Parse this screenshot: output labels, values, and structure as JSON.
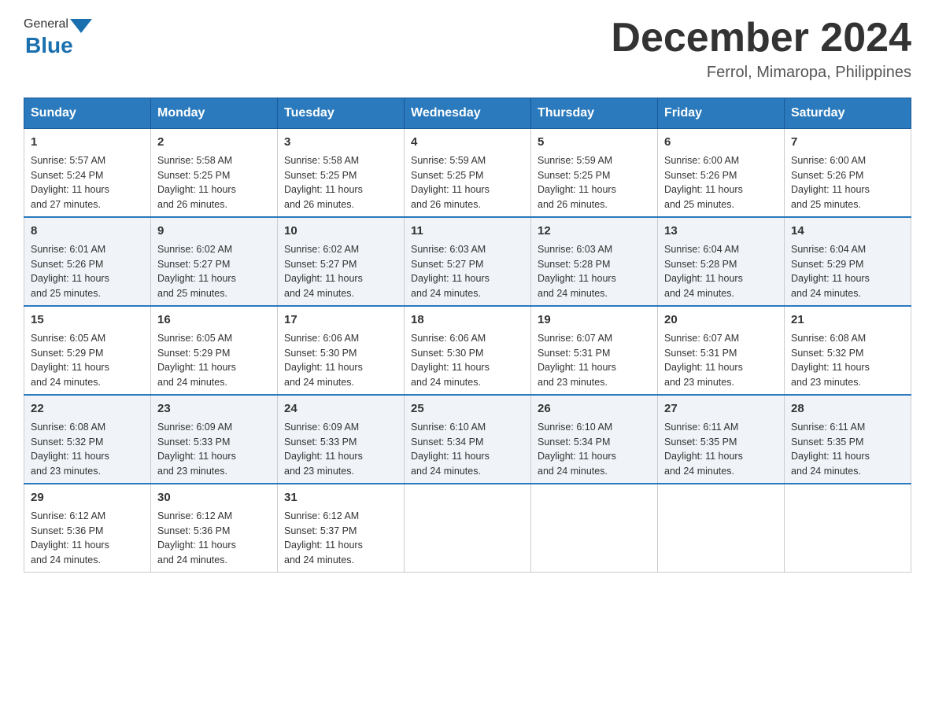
{
  "header": {
    "title": "December 2024",
    "location": "Ferrol, Mimaropa, Philippines",
    "logo_general": "General",
    "logo_blue": "Blue"
  },
  "days_of_week": [
    "Sunday",
    "Monday",
    "Tuesday",
    "Wednesday",
    "Thursday",
    "Friday",
    "Saturday"
  ],
  "weeks": [
    [
      {
        "day": "1",
        "sunrise": "5:57 AM",
        "sunset": "5:24 PM",
        "daylight": "11 hours and 27 minutes."
      },
      {
        "day": "2",
        "sunrise": "5:58 AM",
        "sunset": "5:25 PM",
        "daylight": "11 hours and 26 minutes."
      },
      {
        "day": "3",
        "sunrise": "5:58 AM",
        "sunset": "5:25 PM",
        "daylight": "11 hours and 26 minutes."
      },
      {
        "day": "4",
        "sunrise": "5:59 AM",
        "sunset": "5:25 PM",
        "daylight": "11 hours and 26 minutes."
      },
      {
        "day": "5",
        "sunrise": "5:59 AM",
        "sunset": "5:25 PM",
        "daylight": "11 hours and 26 minutes."
      },
      {
        "day": "6",
        "sunrise": "6:00 AM",
        "sunset": "5:26 PM",
        "daylight": "11 hours and 25 minutes."
      },
      {
        "day": "7",
        "sunrise": "6:00 AM",
        "sunset": "5:26 PM",
        "daylight": "11 hours and 25 minutes."
      }
    ],
    [
      {
        "day": "8",
        "sunrise": "6:01 AM",
        "sunset": "5:26 PM",
        "daylight": "11 hours and 25 minutes."
      },
      {
        "day": "9",
        "sunrise": "6:02 AM",
        "sunset": "5:27 PM",
        "daylight": "11 hours and 25 minutes."
      },
      {
        "day": "10",
        "sunrise": "6:02 AM",
        "sunset": "5:27 PM",
        "daylight": "11 hours and 24 minutes."
      },
      {
        "day": "11",
        "sunrise": "6:03 AM",
        "sunset": "5:27 PM",
        "daylight": "11 hours and 24 minutes."
      },
      {
        "day": "12",
        "sunrise": "6:03 AM",
        "sunset": "5:28 PM",
        "daylight": "11 hours and 24 minutes."
      },
      {
        "day": "13",
        "sunrise": "6:04 AM",
        "sunset": "5:28 PM",
        "daylight": "11 hours and 24 minutes."
      },
      {
        "day": "14",
        "sunrise": "6:04 AM",
        "sunset": "5:29 PM",
        "daylight": "11 hours and 24 minutes."
      }
    ],
    [
      {
        "day": "15",
        "sunrise": "6:05 AM",
        "sunset": "5:29 PM",
        "daylight": "11 hours and 24 minutes."
      },
      {
        "day": "16",
        "sunrise": "6:05 AM",
        "sunset": "5:29 PM",
        "daylight": "11 hours and 24 minutes."
      },
      {
        "day": "17",
        "sunrise": "6:06 AM",
        "sunset": "5:30 PM",
        "daylight": "11 hours and 24 minutes."
      },
      {
        "day": "18",
        "sunrise": "6:06 AM",
        "sunset": "5:30 PM",
        "daylight": "11 hours and 24 minutes."
      },
      {
        "day": "19",
        "sunrise": "6:07 AM",
        "sunset": "5:31 PM",
        "daylight": "11 hours and 23 minutes."
      },
      {
        "day": "20",
        "sunrise": "6:07 AM",
        "sunset": "5:31 PM",
        "daylight": "11 hours and 23 minutes."
      },
      {
        "day": "21",
        "sunrise": "6:08 AM",
        "sunset": "5:32 PM",
        "daylight": "11 hours and 23 minutes."
      }
    ],
    [
      {
        "day": "22",
        "sunrise": "6:08 AM",
        "sunset": "5:32 PM",
        "daylight": "11 hours and 23 minutes."
      },
      {
        "day": "23",
        "sunrise": "6:09 AM",
        "sunset": "5:33 PM",
        "daylight": "11 hours and 23 minutes."
      },
      {
        "day": "24",
        "sunrise": "6:09 AM",
        "sunset": "5:33 PM",
        "daylight": "11 hours and 23 minutes."
      },
      {
        "day": "25",
        "sunrise": "6:10 AM",
        "sunset": "5:34 PM",
        "daylight": "11 hours and 24 minutes."
      },
      {
        "day": "26",
        "sunrise": "6:10 AM",
        "sunset": "5:34 PM",
        "daylight": "11 hours and 24 minutes."
      },
      {
        "day": "27",
        "sunrise": "6:11 AM",
        "sunset": "5:35 PM",
        "daylight": "11 hours and 24 minutes."
      },
      {
        "day": "28",
        "sunrise": "6:11 AM",
        "sunset": "5:35 PM",
        "daylight": "11 hours and 24 minutes."
      }
    ],
    [
      {
        "day": "29",
        "sunrise": "6:12 AM",
        "sunset": "5:36 PM",
        "daylight": "11 hours and 24 minutes."
      },
      {
        "day": "30",
        "sunrise": "6:12 AM",
        "sunset": "5:36 PM",
        "daylight": "11 hours and 24 minutes."
      },
      {
        "day": "31",
        "sunrise": "6:12 AM",
        "sunset": "5:37 PM",
        "daylight": "11 hours and 24 minutes."
      },
      null,
      null,
      null,
      null
    ]
  ],
  "labels": {
    "sunrise": "Sunrise:",
    "sunset": "Sunset:",
    "daylight": "Daylight:"
  }
}
